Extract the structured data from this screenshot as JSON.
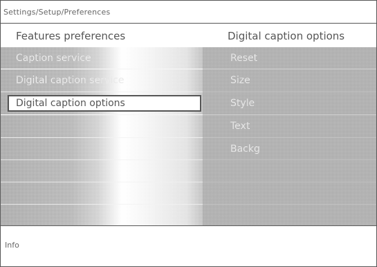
{
  "breadcrumb": "Settings/Setup/Preferences",
  "left_title": "Features preferences",
  "right_title": "Digital caption options",
  "left_items": [
    "Caption service",
    "Digital caption service",
    "Digital caption options"
  ],
  "right_items": [
    "Reset",
    "Size",
    "Style",
    "Text",
    "Backg"
  ],
  "info_label": "Info",
  "colors": {
    "panel_gray": "#a3a3a3",
    "frame": "#555555",
    "selected_bg": "#ffffff"
  }
}
